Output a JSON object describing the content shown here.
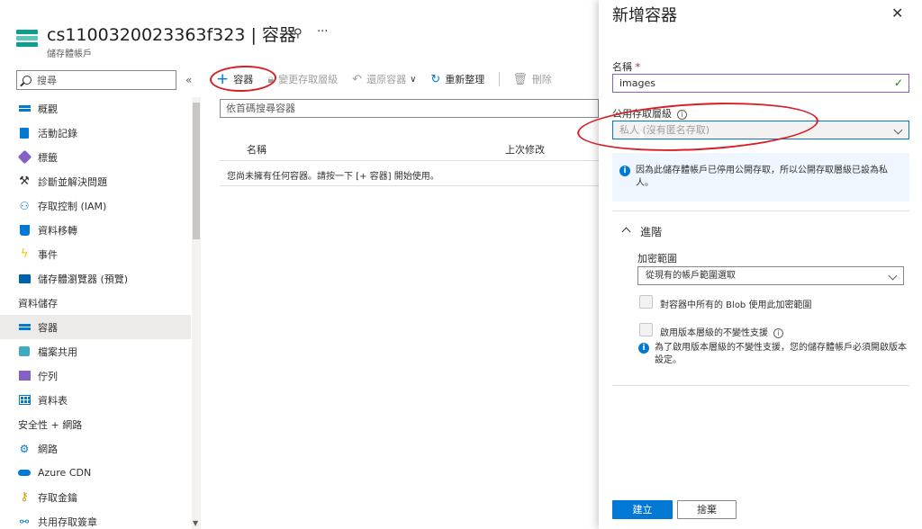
{
  "header": {
    "title": "cs1100320023363f323 | 容器",
    "subtitle": "儲存體帳戶",
    "pin_icon": "pin-icon",
    "more_label": "···"
  },
  "sidebar": {
    "search_placeholder": "搜尋",
    "collapse_label": "«",
    "items": [
      {
        "label": "概觀",
        "icon": "overview-icon"
      },
      {
        "label": "活動記錄",
        "icon": "activity-log-icon"
      },
      {
        "label": "標籤",
        "icon": "tag-icon"
      },
      {
        "label": "診斷並解決問題",
        "icon": "wrench-icon"
      },
      {
        "label": "存取控制 (IAM)",
        "icon": "people-icon"
      },
      {
        "label": "資料移轉",
        "icon": "data-migration-icon"
      },
      {
        "label": "事件",
        "icon": "lightning-icon"
      },
      {
        "label": "儲存體瀏覽器 (預覽)",
        "icon": "storage-explorer-icon"
      }
    ],
    "section_data": "資料儲存",
    "data_items": [
      {
        "label": "容器",
        "icon": "container-icon",
        "active": true
      },
      {
        "label": "檔案共用",
        "icon": "file-share-icon"
      },
      {
        "label": "佇列",
        "icon": "queue-icon"
      },
      {
        "label": "資料表",
        "icon": "table-icon"
      }
    ],
    "section_security": "安全性 + 網路",
    "security_items": [
      {
        "label": "網路",
        "icon": "network-icon"
      },
      {
        "label": "Azure CDN",
        "icon": "cdn-icon"
      },
      {
        "label": "存取金鑰",
        "icon": "key-icon"
      },
      {
        "label": "共用存取簽章",
        "icon": "link-icon"
      }
    ]
  },
  "toolbar": {
    "add_container": "容器",
    "change_access": "變更存取層級",
    "restore": "還原容器",
    "refresh": "重新整理",
    "delete": "刪除"
  },
  "main": {
    "filter_placeholder": "依首碼搜尋容器",
    "col_name": "名稱",
    "col_modified": "上次修改",
    "empty_message": "您尚未擁有任何容器。請按一下 [+ 容器] 開始使用。"
  },
  "panel": {
    "title": "新增容器",
    "close_label": "✕",
    "name_label": "名稱",
    "required_mark": "*",
    "name_value": "images",
    "access_label": "公用存取層級",
    "access_value": "私人 (沒有匿名存取)",
    "banner_text": "因為此儲存體帳戶已停用公開存取，所以公開存取層級已設為私人。",
    "advanced_label": "進階",
    "encryption_label": "加密範圍",
    "encryption_value": "從現有的帳戶範圍選取",
    "cb1_label": "對容器中所有的 Blob 使用此加密範圍",
    "cb2_label": "啟用版本層級的不變性支援",
    "note_text": "為了啟用版本層級的不變性支援，您的儲存體帳戶必須開啟版本設定。",
    "create_button": "建立",
    "discard_button": "捨棄"
  },
  "colors": {
    "accent": "#0078d4",
    "annotation": "#d61f26",
    "valid": "#107c10"
  }
}
